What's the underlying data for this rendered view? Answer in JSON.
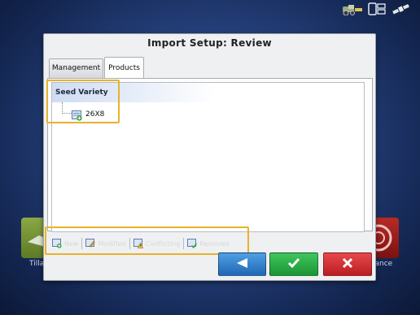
{
  "dialog": {
    "title": "Import Setup: Review"
  },
  "tabs": [
    {
      "label": "Management",
      "active": false
    },
    {
      "label": "Products",
      "active": true
    }
  ],
  "tree": {
    "header": "Seed Variety",
    "items": [
      {
        "label": "26X8",
        "icon": "new-product-icon"
      }
    ]
  },
  "legend": {
    "items": [
      {
        "label": "New",
        "icon": "new-icon"
      },
      {
        "label": "Modified",
        "icon": "modified-icon"
      },
      {
        "label": "Conflicting",
        "icon": "conflicting-icon"
      },
      {
        "label": "Resolved",
        "icon": "resolved-icon"
      }
    ]
  },
  "buttons": {
    "back_icon": "back-arrow-icon",
    "accept_icon": "checkmark-icon",
    "cancel_icon": "x-icon"
  },
  "background": {
    "left_tile_label": "Tilla",
    "right_tile_label": "lance"
  },
  "colors": {
    "highlight": "#e8b22a",
    "back_button": "#2f7fd0",
    "accept_button": "#2bab47",
    "cancel_button": "#d0292d"
  }
}
